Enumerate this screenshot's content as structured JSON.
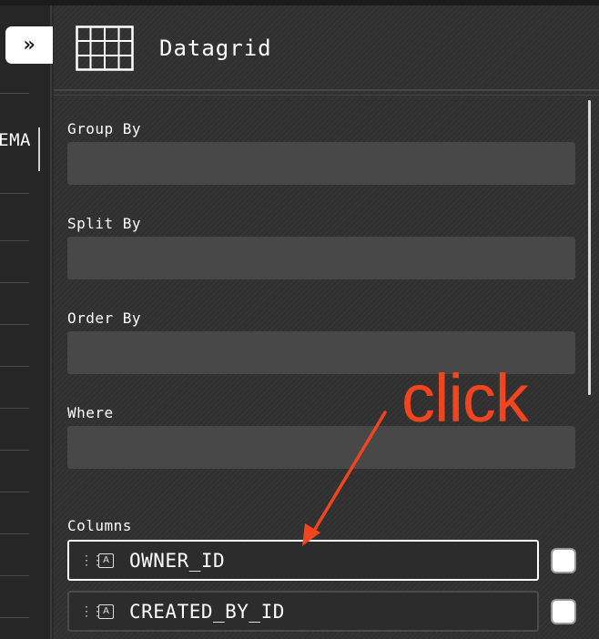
{
  "sidebar": {
    "expand_glyph": "»",
    "partial_text": "SCHEMA"
  },
  "panel": {
    "title": "Datagrid",
    "grid_icon": "datagrid-icon"
  },
  "fields": [
    {
      "label": "Group By",
      "value": ""
    },
    {
      "label": "Split By",
      "value": ""
    },
    {
      "label": "Order By",
      "value": ""
    },
    {
      "label": "Where",
      "value": ""
    }
  ],
  "columns": {
    "label": "Columns",
    "items": [
      {
        "name": "OWNER_ID",
        "type_glyph": "A",
        "checked": false
      },
      {
        "name": "CREATED_BY_ID",
        "type_glyph": "A",
        "checked": false
      }
    ]
  },
  "annotation": {
    "text": "click",
    "color": "#f0451e"
  },
  "colors": {
    "background": "#2a2a2a",
    "field_fill": "#484848",
    "accent_annotation": "#f0451e"
  }
}
